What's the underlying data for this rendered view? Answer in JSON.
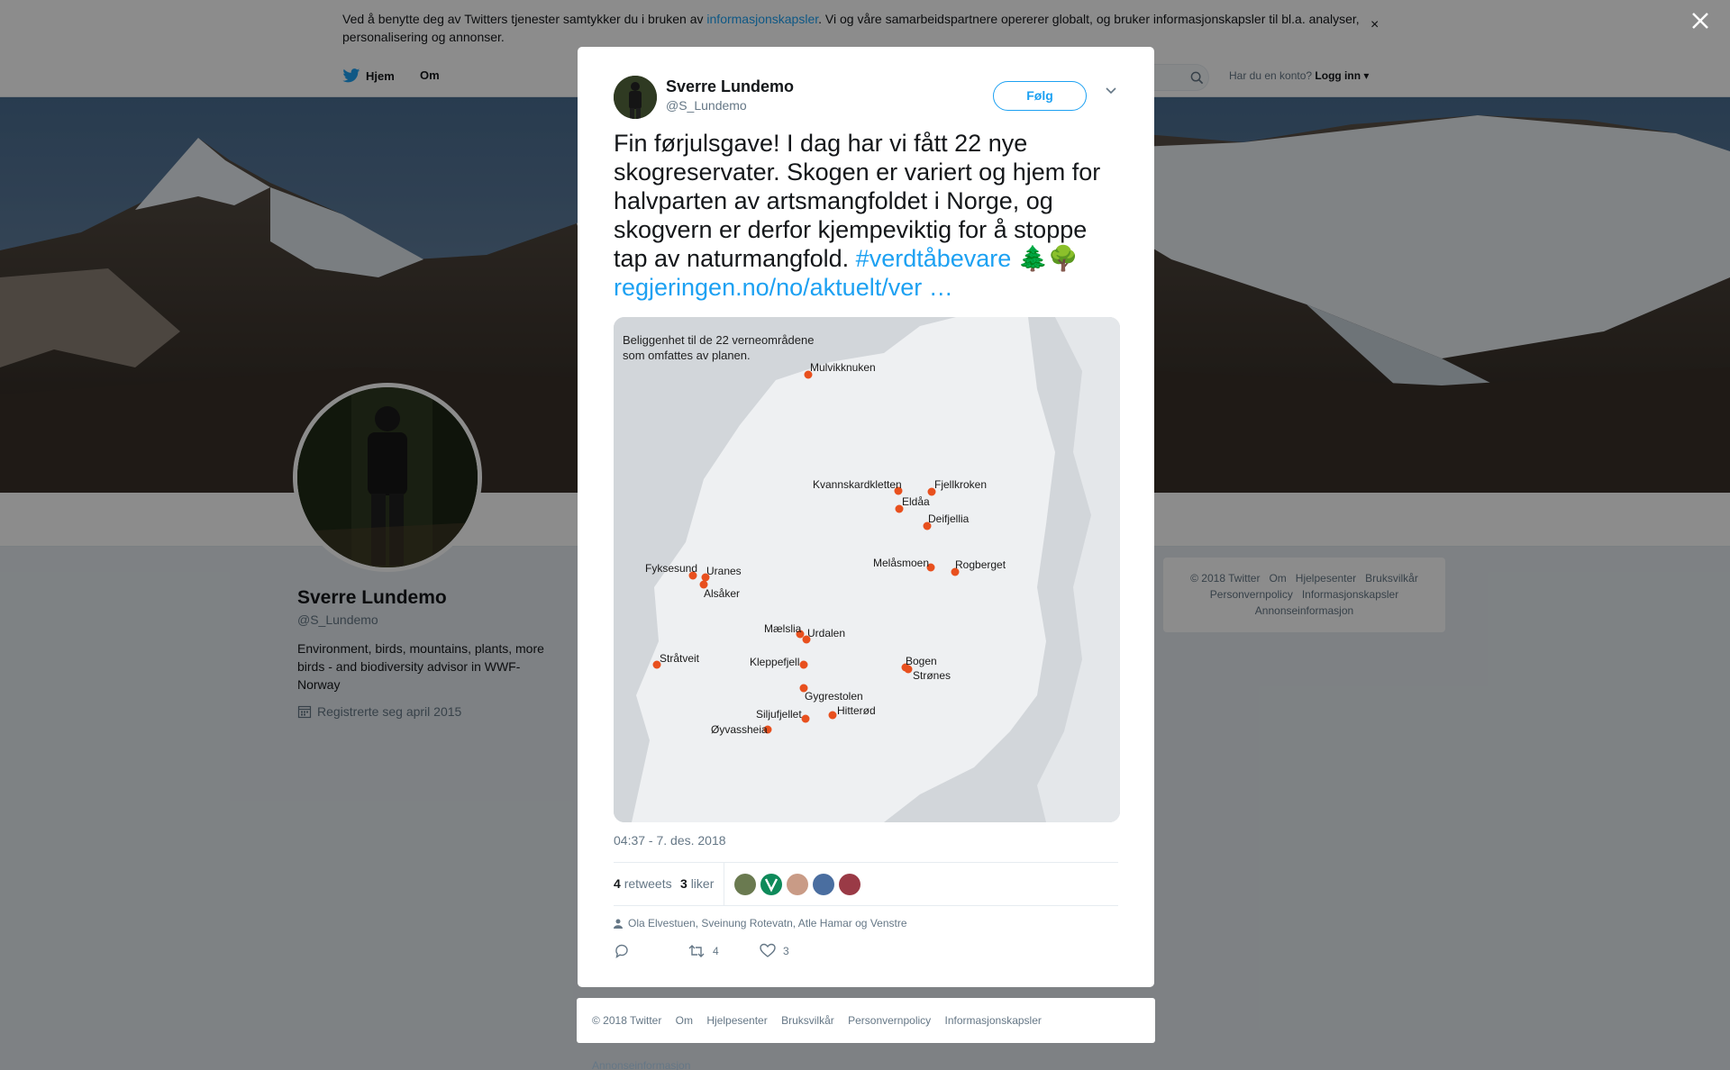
{
  "cookie": {
    "text_before": "Ved å benytte deg av Twitters tjenester samtykker du i bruken av ",
    "link": "informasjonskapsler",
    "text_after": ". Vi og våre samarbeidspartnere opererer globalt, og bruker informasjonskapsler til bl.a. analyser, personalisering og annonser.",
    "close": "×"
  },
  "nav": {
    "home": "Hjem",
    "about": "Om",
    "login_prompt": "Har du en konto?",
    "login": "Logg inn"
  },
  "profile": {
    "name": "Sverre Lundemo",
    "handle": "@S_Lundemo",
    "bio": "Environment, birds, mountains, plants, more birds - and biodiversity advisor in WWF-Norway",
    "joined": "Registrerte seg april 2015"
  },
  "side_footer": [
    "© 2018 Twitter",
    "Om",
    "Hjelpesenter",
    "Bruksvilkår",
    "Personvernpolicy",
    "Informasjonskapsler",
    "Annonseinformasjon"
  ],
  "tweet": {
    "author_name": "Sverre Lundemo",
    "author_handle": "@S_Lundemo",
    "follow": "Følg",
    "text": "Fin førjulsgave! I dag har vi fått 22 nye skogreservater. Skogen er variert og hjem for halvparten av artsmangfoldet i Norge, og skogvern er derfor kjempeviktig for å stoppe tap av naturmangfold. ",
    "hashtag": "#verdtåbevare",
    "emoji": "🌲🌳",
    "link": "regjeringen.no/no/aktuelt/ver …",
    "time": "04:37 - 7. des. 2018",
    "retweets_count": "4",
    "retweets_label": "retweets",
    "likes_count": "3",
    "likes_label": "liker",
    "mentions": "Ola Elvestuen, Sveinung Rotevatn, Atle Hamar og Venstre",
    "action_retweets": "4",
    "action_likes": "3"
  },
  "map": {
    "caption_line1": "Beliggenhet til de 22 verneområdene",
    "caption_line2": "som omfattes av planen.",
    "places": [
      {
        "name": "Mulvikknuken"
      },
      {
        "name": "Kvannskardkletten"
      },
      {
        "name": "Fjellkroken"
      },
      {
        "name": "Eldåa"
      },
      {
        "name": "Deifjellia"
      },
      {
        "name": "Melåsmoen"
      },
      {
        "name": "Rogberget"
      },
      {
        "name": "Fyksesund"
      },
      {
        "name": "Uranes"
      },
      {
        "name": "Alsåker"
      },
      {
        "name": "Mælslia"
      },
      {
        "name": "Urdalen"
      },
      {
        "name": "Stråtveit"
      },
      {
        "name": "Kleppefjell"
      },
      {
        "name": "Bogen"
      },
      {
        "name": "Strønes"
      },
      {
        "name": "Gygrestolen"
      },
      {
        "name": "Siljufjellet"
      },
      {
        "name": "Hitterød"
      },
      {
        "name": "Øyvassheia"
      }
    ]
  },
  "footer": [
    "© 2018 Twitter",
    "Om",
    "Hjelpesenter",
    "Bruksvilkår",
    "Personvernpolicy",
    "Informasjonskapsler",
    "Annonseinformasjon"
  ],
  "colors": {
    "accent": "#1da1f2",
    "marker": "#e8501e"
  }
}
